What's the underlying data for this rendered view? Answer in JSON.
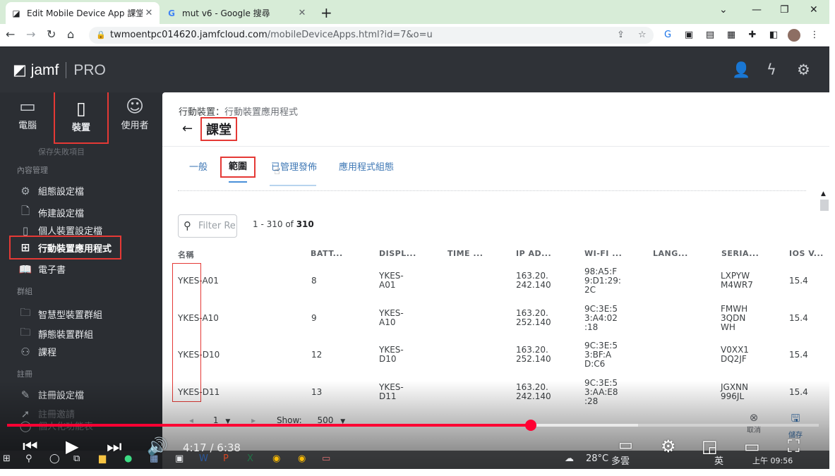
{
  "browser": {
    "tabs": [
      {
        "title": "Edit Mobile Device App 課堂**",
        "favicon": "jamf-icon",
        "active": true
      },
      {
        "title": "mut v6 - Google 搜尋",
        "favicon": "google-icon",
        "active": false
      }
    ],
    "url_host": "twmoentpc014620.jamfcloud.com",
    "url_path": "/mobileDeviceApps.html?id=7&o=u"
  },
  "app": {
    "logo": "jamf",
    "logo_pro": "PRO",
    "topnav": [
      {
        "label": "電腦",
        "icon": "computer-icon"
      },
      {
        "label": "裝置",
        "icon": "mobile-device-icon"
      },
      {
        "label": "使用者",
        "icon": "user-icon"
      }
    ],
    "sidebar": {
      "faded_top": "保存失敗項目",
      "section_content": "內容管理",
      "content_items": [
        "組態設定檔",
        "佈建設定檔",
        "個人裝置設定檔",
        "行動裝置應用程式",
        "電子書"
      ],
      "section_groups": "群組",
      "group_items": [
        "智慧型裝置群組",
        "靜態裝置群組",
        "課程"
      ],
      "section_enroll": "註冊",
      "enroll_items": [
        "註冊設定檔",
        "註冊邀請",
        "個人化功能表"
      ]
    },
    "breadcrumb": {
      "parent": "行動裝置",
      "sep": "：",
      "current": "行動裝置應用程式"
    },
    "title": "課堂",
    "page_tabs": [
      "一般",
      "範圍",
      "已管理發佈",
      "應用程式組態"
    ],
    "filter_placeholder": "Filter Re",
    "count_range": "1 - 310 of ",
    "count_total": "310",
    "columns": [
      "名稱",
      "BATT...",
      "DISPL...",
      "TIME ...",
      "IP AD...",
      "WI-FI ...",
      "LANG...",
      "SERIA...",
      "IOS V..."
    ],
    "rows": [
      {
        "name": "YKES-A01",
        "batt": "8",
        "display": [
          "YKES-",
          "A01"
        ],
        "ip": [
          "163.20.",
          "242.140"
        ],
        "wifi": [
          "98:A5:F",
          "9:D1:29:",
          "2C"
        ],
        "serial": [
          "LXPYW",
          "M4WR7"
        ],
        "ios": "15.4"
      },
      {
        "name": "YKES-A10",
        "batt": "9",
        "display": [
          "YKES-",
          "A10"
        ],
        "ip": [
          "163.20.",
          "252.140"
        ],
        "wifi": [
          "9C:3E:5",
          "3:A4:02",
          ":18"
        ],
        "serial": [
          "FMWH",
          "3QDN",
          "WH"
        ],
        "ios": "15.4"
      },
      {
        "name": "YKES-D10",
        "batt": "12",
        "display": [
          "YKES-",
          "D10"
        ],
        "ip": [
          "163.20.",
          "252.140"
        ],
        "wifi": [
          "9C:3E:5",
          "3:BF:A",
          "D:C6"
        ],
        "serial": [
          "V0XX1",
          "DQ2JF"
        ],
        "ios": "15.4"
      },
      {
        "name": "YKES-D11",
        "batt": "13",
        "display": [
          "YKES-",
          "D11"
        ],
        "ip": [
          "163.20.",
          "242.140"
        ],
        "wifi": [
          "9C:3E:5",
          "3:AA:E8",
          ":28"
        ],
        "serial": [
          "JGXNN",
          "996JL"
        ],
        "ios": "15.4"
      }
    ],
    "pager": {
      "page": "1",
      "show_label": "Show:",
      "show_value": "500"
    },
    "actions": {
      "cancel": "取消",
      "save": "儲存"
    }
  },
  "video": {
    "time_current": "4:17",
    "time_sep": " / ",
    "time_total": "6:38",
    "progress_fraction": 0.645,
    "buffered_fraction": 0.777
  },
  "taskbar": {
    "weather": "28°C",
    "weather_desc": "多雲",
    "ime": "英",
    "clock": "上午 09:56"
  }
}
